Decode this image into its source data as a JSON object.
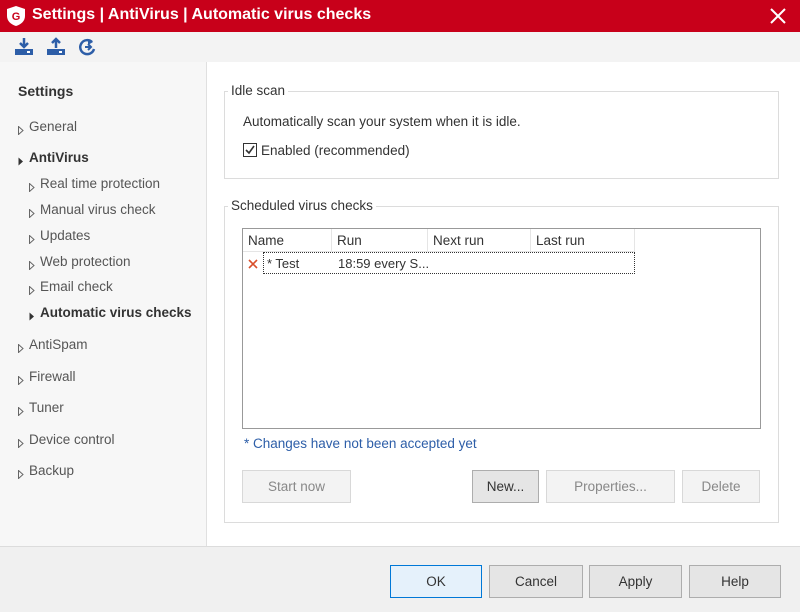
{
  "window": {
    "title": "Settings | AntiVirus | Automatic virus checks",
    "brand_color": "#c8001a"
  },
  "toolbar": {
    "buttons": [
      {
        "icon": "import-icon"
      },
      {
        "icon": "export-icon"
      },
      {
        "icon": "restore-defaults-icon"
      }
    ]
  },
  "sidebar": {
    "title": "Settings",
    "items": [
      {
        "label": "General",
        "expanded": false,
        "active": false
      },
      {
        "label": "AntiVirus",
        "expanded": true,
        "active": false
      },
      {
        "label": "Real time protection",
        "expanded": false,
        "active": false
      },
      {
        "label": "Manual virus check",
        "expanded": false,
        "active": false
      },
      {
        "label": "Updates",
        "expanded": false,
        "active": false
      },
      {
        "label": "Web protection",
        "expanded": false,
        "active": false
      },
      {
        "label": "Email check",
        "expanded": false,
        "active": false
      },
      {
        "label": "Automatic virus checks",
        "expanded": false,
        "active": true
      },
      {
        "label": "AntiSpam",
        "expanded": false,
        "active": false
      },
      {
        "label": "Firewall",
        "expanded": false,
        "active": false
      },
      {
        "label": "Tuner",
        "expanded": false,
        "active": false
      },
      {
        "label": "Device control",
        "expanded": false,
        "active": false
      },
      {
        "label": "Backup",
        "expanded": false,
        "active": false
      }
    ]
  },
  "idle_scan": {
    "label": "Idle scan",
    "description": "Automatically scan your system when it is idle.",
    "checkbox_label": "Enabled (recommended)",
    "checked": true
  },
  "scheduled": {
    "label": "Scheduled virus checks",
    "columns": [
      "Name",
      "Run",
      "Next run",
      "Last run"
    ],
    "rows": [
      {
        "status_icon": "close-icon",
        "name": "* Test",
        "run": "18:59 every S...",
        "next_run": "",
        "last_run": ""
      }
    ],
    "note": "* Changes have not been accepted yet",
    "buttons": {
      "start_now": "Start now",
      "new": "New...",
      "properties": "Properties...",
      "delete": "Delete"
    }
  },
  "footer": {
    "ok": "OK",
    "cancel": "Cancel",
    "apply": "Apply",
    "help": "Help"
  },
  "colors": {
    "accent_blue": "#0078d7",
    "note_blue": "#2d5ea8",
    "delete_red": "#d94f2b"
  }
}
